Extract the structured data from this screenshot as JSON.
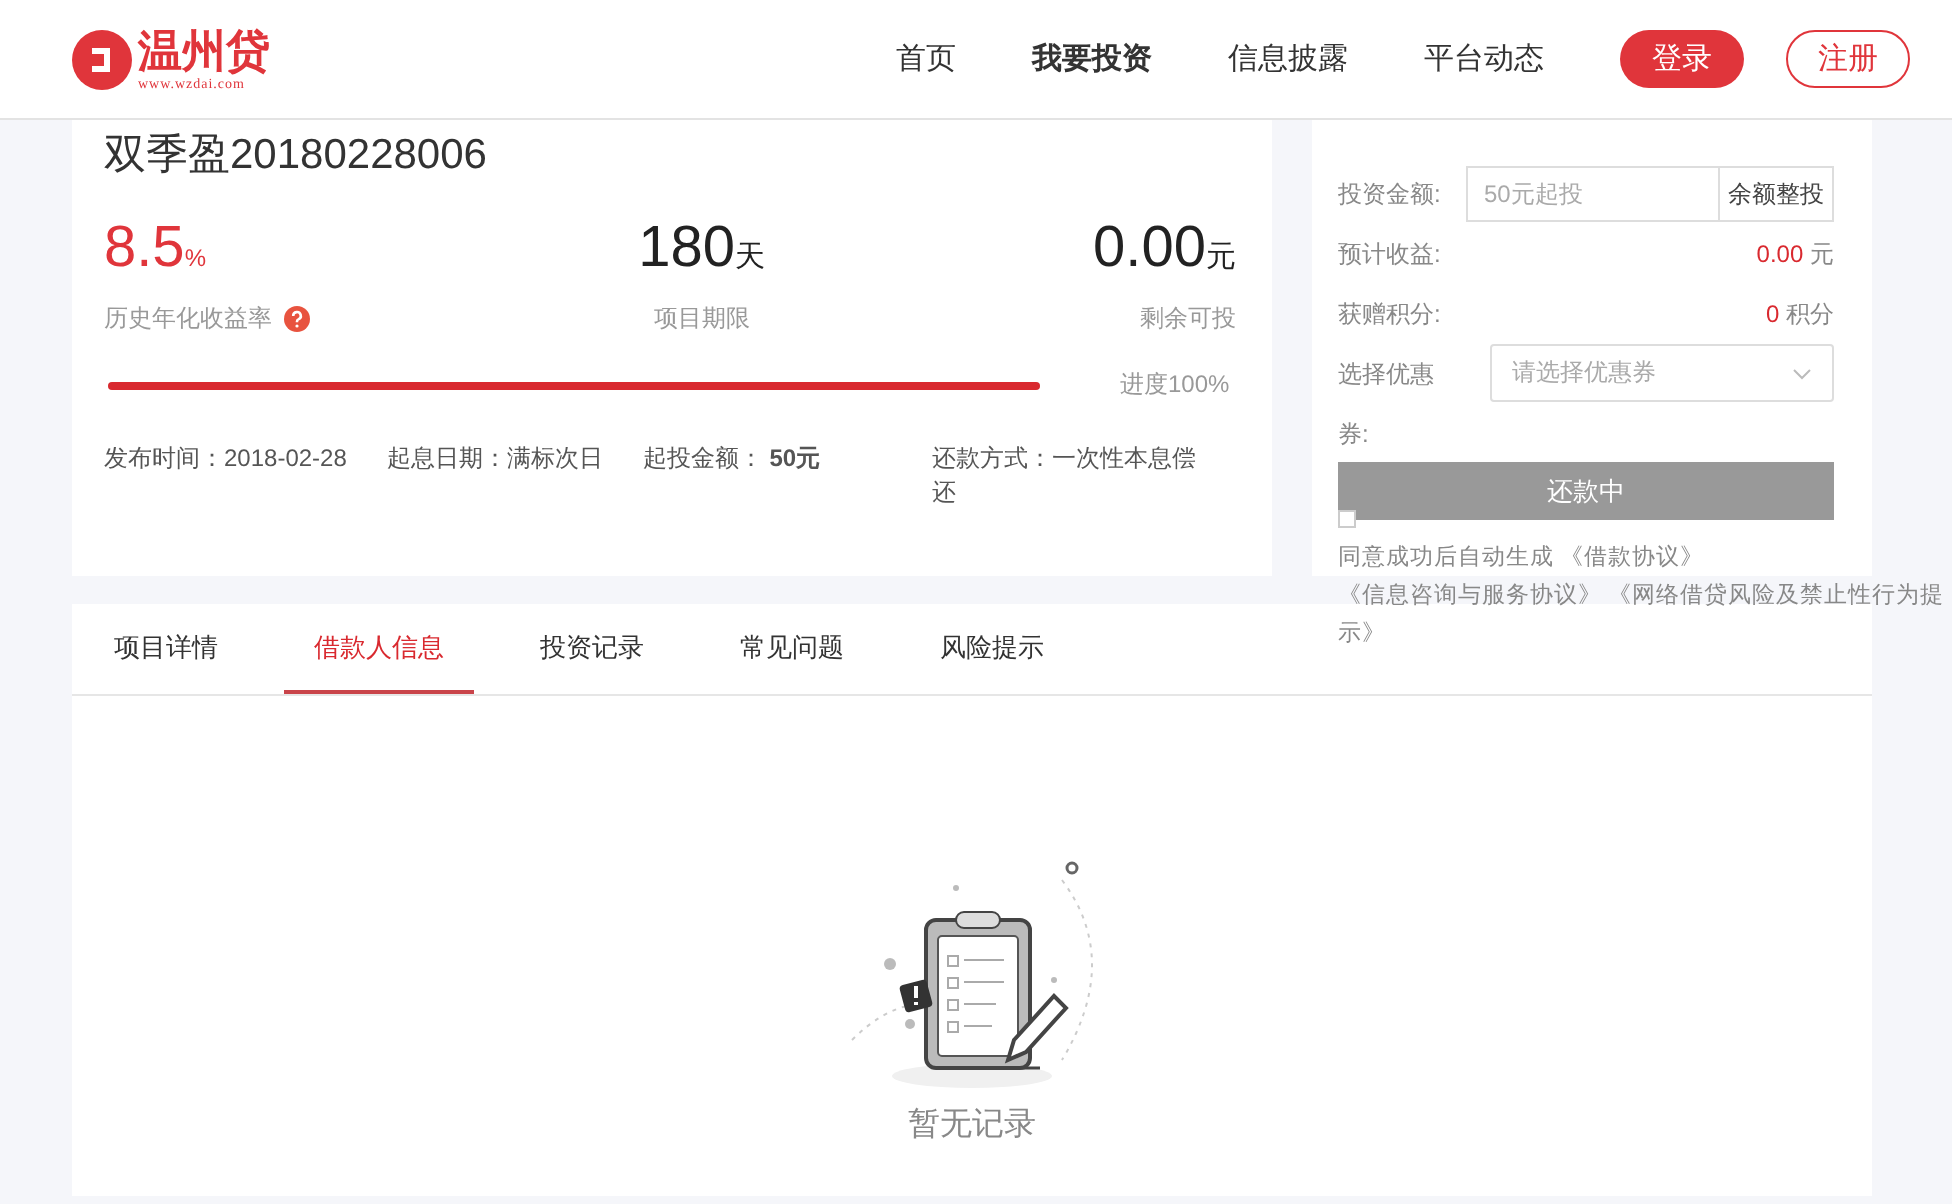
{
  "header": {
    "logo": {
      "name": "温州贷",
      "domain": "www.wzdai.com"
    },
    "nav": [
      {
        "label": "首页",
        "selected": false
      },
      {
        "label": "我要投资",
        "selected": true
      },
      {
        "label": "信息披露",
        "selected": false
      },
      {
        "label": "平台动态",
        "selected": false
      }
    ],
    "buttons": [
      {
        "label": "登录",
        "kind": "primary"
      },
      {
        "label": "注册",
        "kind": "outline"
      }
    ]
  },
  "loan": {
    "title": "双季盈20180228006",
    "stats": [
      {
        "value": "8.5",
        "unit": "%",
        "label": "历史年化收益率",
        "kind": "rate",
        "help": true
      },
      {
        "value": "180",
        "unit": "天",
        "label": "项目期限",
        "kind": "term",
        "help": false
      },
      {
        "value": "0.00",
        "unit": "元",
        "label": "剩余可投",
        "kind": "remain",
        "help": false
      }
    ],
    "progress": {
      "level": 1,
      "reading": "进度100%"
    },
    "details": [
      {
        "label": "发布时间：",
        "value": "2018-02-28",
        "bold": false
      },
      {
        "label": "起息日期：",
        "value": "满标次日",
        "bold": false
      },
      {
        "label": "起投金额：",
        "value": "50元",
        "bold": true
      },
      {
        "label": "还款方式：",
        "value": "一次性本息偿还",
        "bold": false
      }
    ]
  },
  "invest": {
    "amount": {
      "label": "投资金额:",
      "placeholder": "50元起投",
      "button": "余额整投"
    },
    "income": {
      "label": "预计收益:",
      "value": "0.00",
      "unit": "元"
    },
    "points": {
      "label": "获赠积分:",
      "value": "0",
      "unit": "积分"
    },
    "coupon": {
      "label": "选择优惠券:",
      "placeholder": "请选择优惠券"
    },
    "submit": {
      "label": "还款中",
      "disabled": true
    },
    "agree": {
      "checked": false,
      "lines": [
        "同意成功后自动生成 《借款协议》",
        "《信息咨询与服务协议》 《网络借贷风险及禁止性行为提示》"
      ]
    }
  },
  "tabs": [
    {
      "label": "项目详情",
      "selected": false
    },
    {
      "label": "借款人信息",
      "selected": true
    },
    {
      "label": "投资记录",
      "selected": false
    },
    {
      "label": "常见问题",
      "selected": false
    },
    {
      "label": "风险提示",
      "selected": false
    }
  ],
  "empty": {
    "text": "暂无记录"
  }
}
